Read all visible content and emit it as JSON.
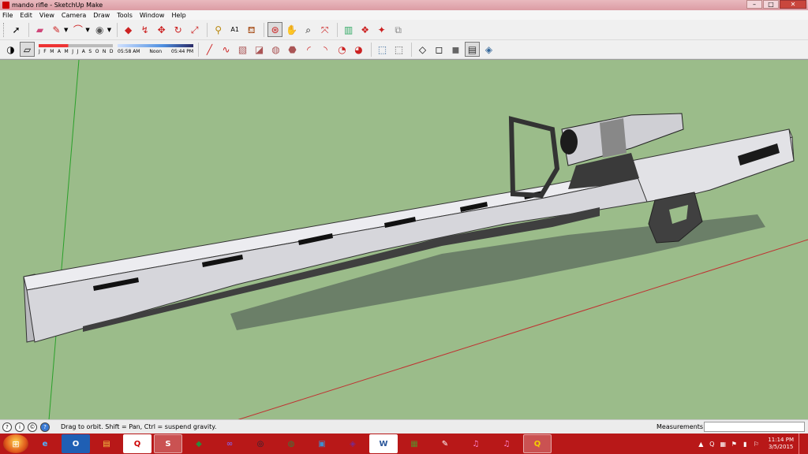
{
  "window": {
    "title": "mando rifle - SketchUp Make",
    "minimize": "–",
    "maximize": "□",
    "close": "✕"
  },
  "menu": [
    "File",
    "Edit",
    "View",
    "Camera",
    "Draw",
    "Tools",
    "Window",
    "Help"
  ],
  "toolbar1": {
    "icons": [
      "select-icon",
      "eraser-icon",
      "pencil-line-icon",
      "arc-icon",
      "shapes-icon",
      "push-pull-icon",
      "follow-me-icon",
      "move-icon",
      "rotate-icon",
      "scale-icon",
      "tape-measure-icon",
      "text-icon",
      "paint-bucket-icon",
      "orbit-icon",
      "pan-icon",
      "zoom-icon",
      "zoom-extents-icon",
      "3d-warehouse-icon",
      "extension-warehouse-icon",
      "layout-icon",
      "send-to-layout-icon"
    ]
  },
  "toolbar2": {
    "shadows": {
      "months": "J F M A M J J A S O N D",
      "time_start": "05:58 AM",
      "time_mid": "Noon",
      "time_end": "05:44 PM"
    },
    "icons": [
      "draw-line-icon",
      "freehand-icon",
      "rectangle-icon",
      "rotated-rectangle-icon",
      "circle-icon",
      "polygon-icon",
      "arc-2pt-icon",
      "arc-3pt-icon",
      "pie-icon",
      "style-xray-icon",
      "style-back-edges-icon",
      "style-wireframe-icon",
      "style-hidden-line-icon",
      "style-shaded-icon",
      "style-shaded-textures-icon",
      "style-monochrome-icon"
    ]
  },
  "status": {
    "hint": "Drag to orbit. Shift = Pan, Ctrl = suspend gravity.",
    "measurements_label": "Measurements",
    "measurements_value": ""
  },
  "taskbar": {
    "start": "⊞",
    "apps": [
      {
        "name": "internet-explorer",
        "glyph": "e"
      },
      {
        "name": "outlook",
        "glyph": "O"
      },
      {
        "name": "file-explorer",
        "glyph": "▤"
      },
      {
        "name": "quicken",
        "glyph": "Q"
      },
      {
        "name": "sketchup",
        "glyph": "S"
      },
      {
        "name": "app-green",
        "glyph": "◆"
      },
      {
        "name": "visual-studio",
        "glyph": "∞"
      },
      {
        "name": "steam",
        "glyph": "◎"
      },
      {
        "name": "halo",
        "glyph": "◍"
      },
      {
        "name": "box-app",
        "glyph": "▣"
      },
      {
        "name": "app-purple",
        "glyph": "◈"
      },
      {
        "name": "word",
        "glyph": "W"
      },
      {
        "name": "minecraft",
        "glyph": "▦"
      },
      {
        "name": "app-red",
        "glyph": "✎"
      },
      {
        "name": "itunes-1",
        "glyph": "♫"
      },
      {
        "name": "itunes-2",
        "glyph": "♫"
      },
      {
        "name": "quicktime",
        "glyph": "Q"
      }
    ],
    "clock_time": "11:14 PM",
    "clock_date": "3/5/2015"
  },
  "colors": {
    "viewport_bg": "#9bbc8a",
    "taskbar": "#b81818",
    "model_light": "#e2e2e6",
    "model_mid": "#c4c4c8",
    "model_dark": "#3f3f3f"
  }
}
